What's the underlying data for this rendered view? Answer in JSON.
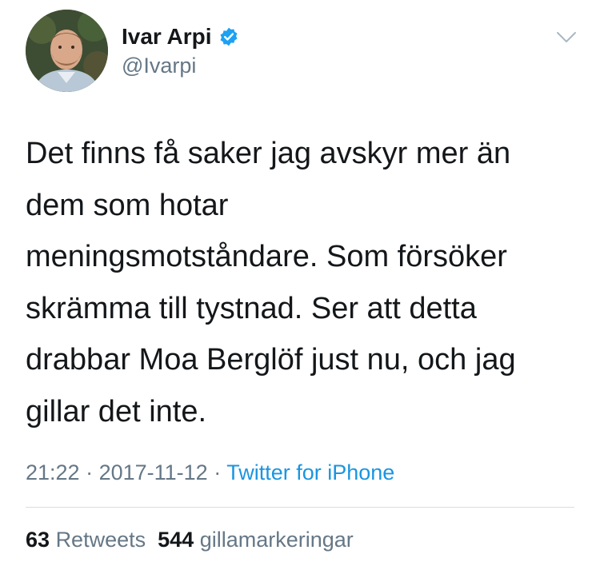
{
  "author": {
    "name": "Ivar Arpi",
    "handle": "@Ivarpi",
    "verified": true
  },
  "tweet": {
    "text": "Det finns få saker jag avskyr mer än\ndem som hotar\nmeningsmotståndare. Som försöker\nskrämma till tystnad. Ser att detta\ndrabbar Moa Berglöf just nu, och jag\ngillar det inte.",
    "time": "21:22",
    "separator1": " · ",
    "date": "2017-11-12",
    "separator2": " · ",
    "source": "Twitter for iPhone"
  },
  "stats": {
    "retweets_count": "63",
    "retweets_label": "Retweets",
    "likes_count": "544",
    "likes_label": "gillamarkeringar"
  },
  "colors": {
    "text": "#14171a",
    "secondary": "#657786",
    "link": "#1b95e0",
    "verified": "#1da1f2",
    "divider": "#d9dee2"
  },
  "icons": {
    "verified": "verified-badge-icon",
    "menu": "chevron-down-icon"
  }
}
